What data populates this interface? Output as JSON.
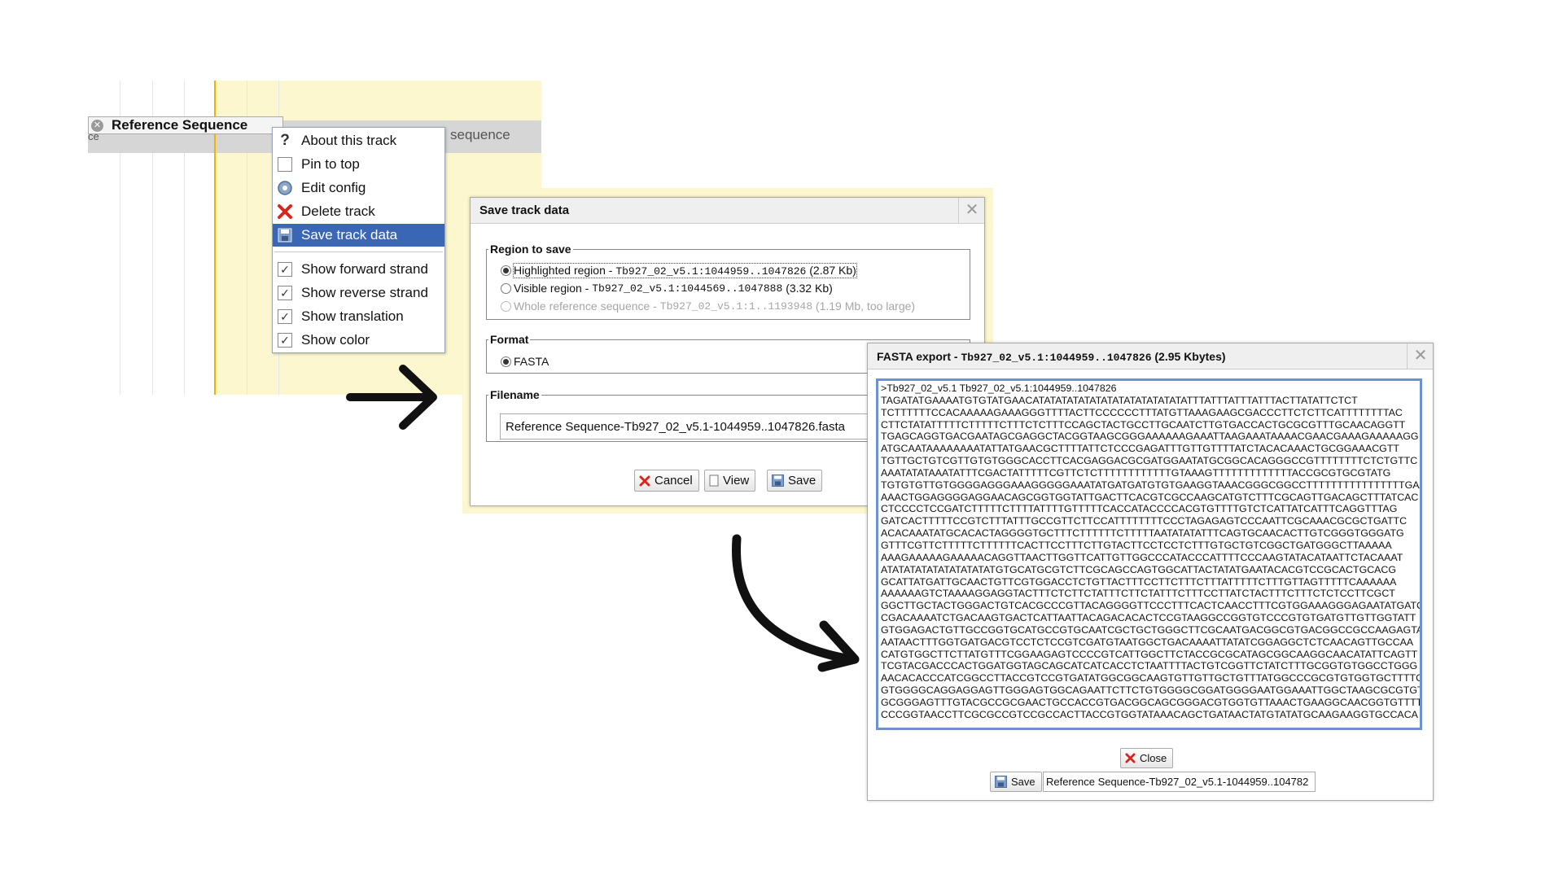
{
  "track": {
    "label": "Reference Sequence",
    "background_text": "sequence",
    "cut_text": "ce"
  },
  "context_menu": {
    "items": [
      {
        "label": "About this track",
        "icon": "help-icon"
      },
      {
        "label": "Pin to top",
        "icon": "pin-checkbox-icon"
      },
      {
        "label": "Edit config",
        "icon": "gear-icon"
      },
      {
        "label": "Delete track",
        "icon": "delete-icon"
      },
      {
        "label": "Save track data",
        "icon": "floppy-disk-icon",
        "selected": true
      }
    ],
    "toggles": [
      {
        "label": "Show forward strand",
        "checked": true
      },
      {
        "label": "Show reverse strand",
        "checked": true
      },
      {
        "label": "Show translation",
        "checked": true
      },
      {
        "label": "Show color",
        "checked": true
      }
    ]
  },
  "save_dialog": {
    "title": "Save track data",
    "region_legend": "Region to save",
    "regions": [
      {
        "label": "Highlighted region",
        "locus": "Tb927_02_v5.1:1044959..1047826",
        "size": "(2.87 Kb)",
        "selected": true,
        "enabled": true
      },
      {
        "label": "Visible region",
        "locus": "Tb927_02_v5.1:1044569..1047888",
        "size": "(3.32 Kb)",
        "selected": false,
        "enabled": true
      },
      {
        "label": "Whole reference sequence",
        "locus": "Tb927_02_v5.1:1..1193948",
        "size": "(1.19 Mb, too large)",
        "selected": false,
        "enabled": false
      }
    ],
    "format_legend": "Format",
    "format_option": "FASTA",
    "filename_legend": "Filename",
    "filename_value": "Reference Sequence-Tb927_02_v5.1-1044959..1047826.fasta",
    "buttons": {
      "cancel": "Cancel",
      "view": "View",
      "save": "Save"
    }
  },
  "fasta_dialog": {
    "title_prefix": "FASTA export - ",
    "title_locus": "Tb927_02_v5.1:1044959..1047826",
    "title_suffix": " (2.95 Kbytes)",
    "lines": [
      ">Tb927_02_v5.1 Tb927_02_v5.1:1044959..1047826",
      "TAGATATGAAAATGTGTATGAACATATATATATATATATATATATATATATTTATTTATTTATTTACTTATATTCTCT",
      "TCTTTTTTCCACAAAAAGAAAGGGTTTTACTTCCCCCCTTTATGTTAAAGAAGCGACCCTTCTCTTCATTTTTTTTAC",
      "CTTCTATATTTTTCTTTTTCTTTCTCTTTCCAGCTACTGCCTTGCAATCTTGTGACCACTGCGCGTTTGCAACAGGTT",
      "TGAGCAGGTGACGAATAGCGAGGCTACGGTAAGCGGGAAAAAAGAAATTAAGAAATAAAACGAACGAAAGAAAAAGG",
      "ATGCAATAAAAAAAATATTATGAACGCTTTTATTCTCCCGAGATTTGTTGTTTTATCTACACAAACTGCGGAAACGTT",
      "TGTTGCTGTCGTTGTGTGGGCACCTTCACGAGGACGCGATGGAATATGCGGCACAGGGCCGTTTTTTTTCTCTGTTC",
      "AAATATATAAATATTTCGACTATTTTTCGTTCTCTTTTTTTTTTTTGTAAAGTTTTTTTTTTTTTACCGCGTGCGTATG",
      "TGTGTGTTGTGGGGAGGGAAAGGGGGAAATATGATGATGTGTGAAGGTAAACGGGCGGCCTTTTTTTTTTTTTTTTGAA",
      "AAACTGGAGGGGAGGAACAGCGGTGGTATTGACTTCACGTCGCCAAGCATGTCTTTCGCAGTTGACAGCTTTATCAC",
      "CTCCCCTCCGATCTTTTTCTTTTATTTTGTTTTTCACCATACCCCACGTGTTTTGTCTCATTATCATTTCAGGTTTAG",
      "GATCACTTTTTCCGTCTTTATTTGCCGTTCTTCCATTTTTTTTCCCTAGAGAGTCCCAATTCGCAAACGCGCTGATTC",
      "ACACAAATATGCACACTAGGGGTGCTTTCTTTTTTCTTTTTAATATATATTTCAGTGCAACACTTGTCGGGTGGGATG",
      "GTTTCGTTCTTTTTCTTTTTTCACTTCCTTTCTTGTACTTCCTCCTCTTTGTGCTGTCGGCTGATGGGCTTAAAAA",
      "AAAGAAAAAGAAAAACAGGTTAACTTGGTTCATTGTTGGCCCATACCCATTTTCCCAAGTATACATAATTCTACAAAT",
      "ATATATATATATATATATATGTGCATGCGTCTTCGCAGCCAGTGGCATTACTATATGAATACACGTCCGCACTGCACG",
      "GCATTATGATTGCAACTGTTCGTGGACCTCTGTTACTTTCCTTCTTTCTTTATTTTTCTTTGTTAGTTTTTCAAAAAA",
      "AAAAAAGTCTAAAAGGAGGTACTTTCTCTTCTATTTCTTCTATTTCTTTCCTTATCTACTTTCTTTCTCTCCTTCGCT",
      "GGCTTGCTACTGGGACTGTCACGCCCGTTACAGGGGTTCCCTTTCACTCAACCTTTCGTGGAAAGGGAGAATATGATC",
      "CGACAAAATCTGACAAGTGACTCATTAATTACAGACACACTCCGTAAGGCCGGTGTCCCGTGTGATGTTGTTGGTATT",
      "GTGGAGACTGTTGCCGGTGCATGCCGTGCAATCGCTGCTGGGCTTCGCAATGACGGCGTGACGGCCGCCAAGAGTA",
      "AATAACTTTGGTGATGACGTCCTCTCCGTCGATGTAATGGCTGACAAAATTATATCGGAGGCTCTCAACAGTTGCCAA",
      "CATGTGGCTTCTTATGTTTCGGAAGAGTCCCCGTCATTGGCTTCTACCGCGCATAGCGGCAAGGCAACATATTCAGTT",
      "TCGTACGACCCACTGGATGGTAGCAGCATCATCACCTCTAATTTTACTGTCGGTTCTATCTTTGCGGTGTGGCCTGGG",
      "AACACACCCATCGGCCTTACCGTCCGTGATATGGCGGCAAGTGTTGTTGCTGTTTATGGCCCGCGTGTGGTGCTTTTC",
      "GTGGGGCAGGAGGAGTTGGGAGTGGCAGAATTCTTCTGTGGGGCGGATGGGGAATGGAAATTGGCTAAGCGCGTGT",
      "GCGGGAGTTTGTACGCCGCGAACTGCCACCGTGACGGCAGCGGGACGTGGTGTTAAACTGAAGGCAACGGTGTTTT",
      "CCCGGTAACCTTCGCGCCGTCCGCCACTTACCGTGGTATAAACAGCTGATAACTATGTATATGCAAGAAGGTGCCACA"
    ],
    "close_label": "Close",
    "save_label": "Save",
    "save_filename": "Reference Sequence-Tb927_02_v5.1-1044959..104782"
  },
  "colors": {
    "menu_selected": "#3a67b5",
    "highlight_yellow": "#fdf7cf",
    "highlight_line": "#f0b400",
    "fasta_border": "#6c93cf",
    "delete_red": "#d9261c"
  }
}
